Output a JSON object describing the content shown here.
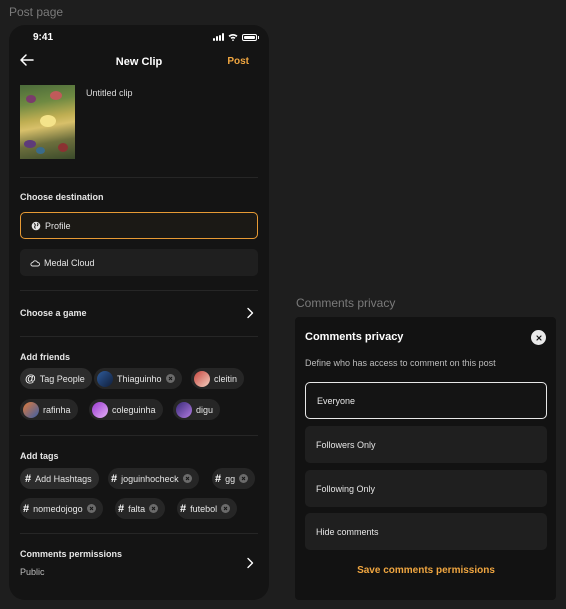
{
  "frames": {
    "post_page_label": "Post page",
    "comments_privacy_label": "Comments privacy"
  },
  "status_bar": {
    "time": "9:41"
  },
  "header": {
    "title": "New Clip",
    "post_label": "Post"
  },
  "clip": {
    "title": "Untitled clip"
  },
  "destination": {
    "title": "Choose destination",
    "options": [
      {
        "label": "Profile",
        "icon": "globe-icon",
        "selected": true
      },
      {
        "label": "Medal Cloud",
        "icon": "cloud-icon",
        "selected": false
      }
    ]
  },
  "game": {
    "title": "Choose a game"
  },
  "friends": {
    "title": "Add friends",
    "action_label": "Tag People",
    "people": [
      "Thiaguinho",
      "cleitin",
      "rafinha",
      "coleguinha",
      "digu"
    ]
  },
  "tags": {
    "title": "Add tags",
    "action_label": "Add Hashtags",
    "items": [
      "joguinhocheck",
      "gg",
      "nomedojogo",
      "falta",
      "futebol"
    ]
  },
  "permissions": {
    "title": "Comments permissions",
    "value": "Public"
  },
  "comments_panel": {
    "title": "Comments privacy",
    "description": "Define who has access to comment on this post",
    "options": [
      {
        "label": "Everyone",
        "selected": true
      },
      {
        "label": "Followers Only",
        "selected": false
      },
      {
        "label": "Following Only",
        "selected": false
      },
      {
        "label": "Hide comments",
        "selected": false
      }
    ],
    "save_label": "Save comments permissions"
  },
  "colors": {
    "accent": "#f0a640",
    "selected_border": "#e79a34",
    "background": "#141414"
  }
}
